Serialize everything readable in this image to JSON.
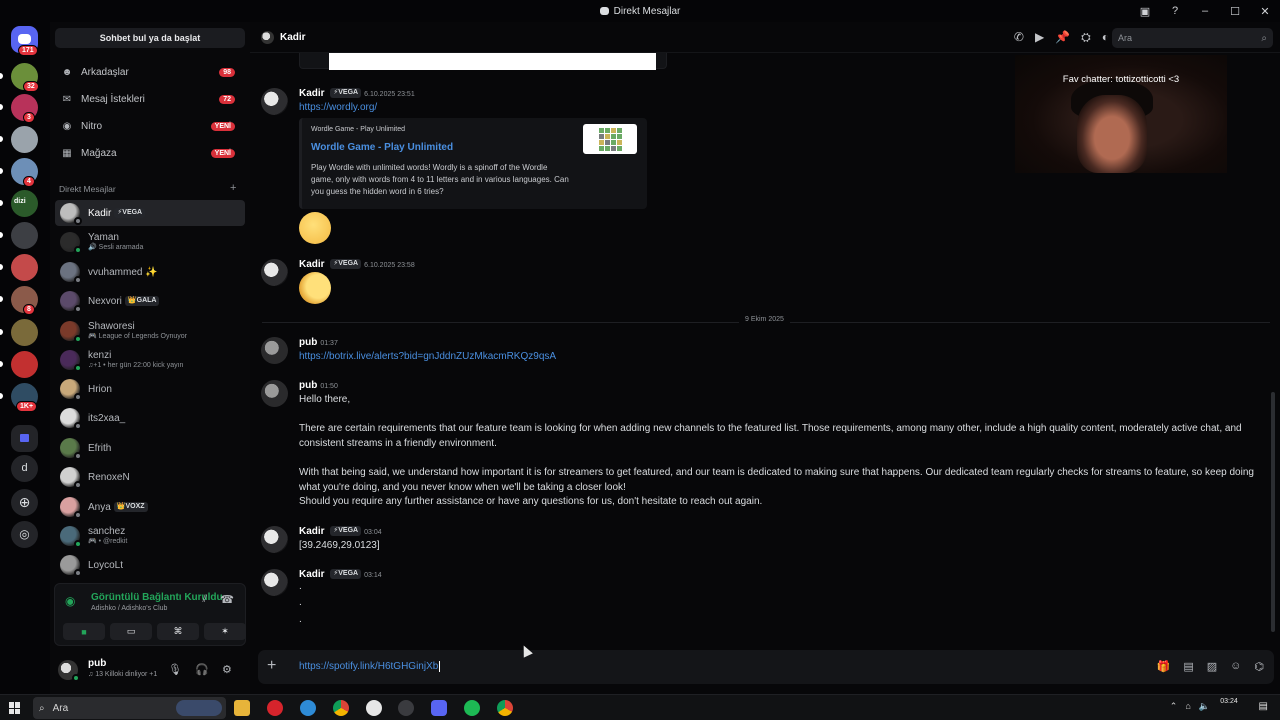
{
  "window": {
    "title": "Direkt Mesajlar",
    "controls": [
      "–",
      "☐",
      "✕"
    ]
  },
  "rail": {
    "home_badge": "171",
    "servers": [
      {
        "color": "#6b8f3a",
        "badge": "32"
      },
      {
        "color": "#b8325a",
        "badge": "3"
      },
      {
        "color": "#9aa3ab",
        "badge": ""
      },
      {
        "color": "#6d8fb7",
        "badge": "4"
      },
      {
        "color": "#2b5a2a",
        "badge": "",
        "label": "dizi"
      },
      {
        "color": "#3d3f44",
        "badge": ""
      },
      {
        "color": "#c44a4a",
        "badge": ""
      },
      {
        "color": "#8b5a4a",
        "badge": "8"
      },
      {
        "color": "#7a6a3a",
        "badge": ""
      },
      {
        "color": "#c23030",
        "badge": ""
      },
      {
        "color": "#2f4c63",
        "badge": "1K+"
      }
    ],
    "folder_letter": "d"
  },
  "dm_column": {
    "find_button": "Sohbet bul ya da başlat",
    "nav": [
      {
        "label": "Arkadaşlar",
        "icon": "friends-icon",
        "count": "98"
      },
      {
        "label": "Mesaj İstekleri",
        "icon": "mail-icon",
        "count": "72"
      },
      {
        "label": "Nitro",
        "icon": "nitro-icon",
        "count": "YENİ"
      },
      {
        "label": "Mağaza",
        "icon": "shop-icon",
        "count": "YENİ"
      }
    ],
    "section": "Direkt Mesajlar",
    "dms": [
      {
        "name": "Kadir",
        "tag": "⚡VEGA",
        "sub": "",
        "color": "#bdbdbd",
        "status": "#7a7d83"
      },
      {
        "name": "Yaman",
        "tag": "",
        "sub": "🔊 Sesli aramada",
        "color": "#2b2b2b",
        "status": "#23a55a"
      },
      {
        "name": "vvuhammed ✨",
        "tag": "",
        "sub": "",
        "color": "#6b7280",
        "status": "#7a7d83"
      },
      {
        "name": "Nexvori",
        "tag": "👑GALA",
        "sub": "",
        "color": "#5b4a6a",
        "status": "#7a7d83"
      },
      {
        "name": "Shaworesi",
        "tag": "",
        "sub": "🎮 League of Legends Oynuyor",
        "color": "#7a3a2a",
        "status": "#23a55a"
      },
      {
        "name": "kenzi",
        "tag": "",
        "sub": "♫+1 • her gün 22:00 kick yayın",
        "color": "#4a2a5a",
        "status": "#23a55a"
      },
      {
        "name": "Hrion",
        "tag": "",
        "sub": "",
        "color": "#c8a87a",
        "status": "#7a7d83"
      },
      {
        "name": "its2xaa_",
        "tag": "",
        "sub": "",
        "color": "#dcdcdc",
        "status": "#7a7d83"
      },
      {
        "name": "Efrith",
        "tag": "",
        "sub": "",
        "color": "#5a7a4a",
        "status": "#7a7d83"
      },
      {
        "name": "RenoxeN",
        "tag": "",
        "sub": "",
        "color": "#d0d0d0",
        "status": "#7a7d83"
      },
      {
        "name": "Anya",
        "tag": "👑VOXZ",
        "sub": "",
        "color": "#d9a0a0",
        "status": "#7a7d83"
      },
      {
        "name": "sanchez",
        "tag": "",
        "sub": "🎮 • @redkit",
        "color": "#4a6a7a",
        "status": "#23a55a"
      },
      {
        "name": "LoycoLt",
        "tag": "",
        "sub": "",
        "color": "#9a9a9a",
        "status": "#7a7d83"
      }
    ],
    "voice": {
      "title": "Görüntülü Bağlantı Kuruldu",
      "subtitle": "Adishko / Adishko's Club"
    },
    "user": {
      "name": "pub",
      "status": "♫ 13 Killoki dinliyor +1"
    }
  },
  "chat": {
    "channel_name": "Kadir",
    "search_placeholder": "Ara",
    "webcam_caption": "Fav chatter: tottizotticotti <3",
    "messages": [
      {
        "author": "Kadir",
        "tag": "⚡VEGA",
        "time": "6.10.2025 23:51",
        "link": "https://wordly.org/"
      },
      {
        "author": "Kadir",
        "tag": "⚡VEGA",
        "time": "6.10.2025 23:58"
      },
      {
        "author": "pub",
        "time": "01:37",
        "link": "https://botrix.live/alerts?bid=gnJddnZUzMkacmRKQz9qsA"
      },
      {
        "author": "pub",
        "time": "01:50",
        "lines": [
          "Hello there,",
          "There are certain requirements that our feature team is looking for when adding new channels to the featured list. Those requirements, among many other, include a high quality content, moderately active chat, and consistent streams in a friendly environment.",
          "With that being said, we understand how important it is for streamers to get featured, and our team is dedicated to making sure that happens. Our dedicated team regularly checks for streams to feature, so keep doing what you're doing, and you never know when we'll be taking a closer look!",
          "Should you require any further assistance or have any questions for us, don't hesitate to reach out again."
        ]
      },
      {
        "author": "Kadir",
        "tag": "⚡VEGA",
        "time": "03:04",
        "text": "[39.2469,29.0123]"
      },
      {
        "author": "Kadir",
        "tag": "⚡VEGA",
        "time": "03:14",
        "dots": [
          ".",
          ".",
          "."
        ]
      }
    ],
    "embed": {
      "provider": "Wordle Game - Play Unlimited",
      "title": "Wordle Game - Play Unlimited",
      "description": "Play Wordle with unlimited words! Wordly is a spinoff of the Wordle game, only with words from 4 to 11 letters and in various languages. Can you guess the hidden word in 6 tries?"
    },
    "date_divider": "9 Ekim 2025",
    "input_value": "https://spotify.link/H6tGHGinjXb"
  },
  "taskbar": {
    "search": "Ara",
    "clock": "03:24"
  }
}
